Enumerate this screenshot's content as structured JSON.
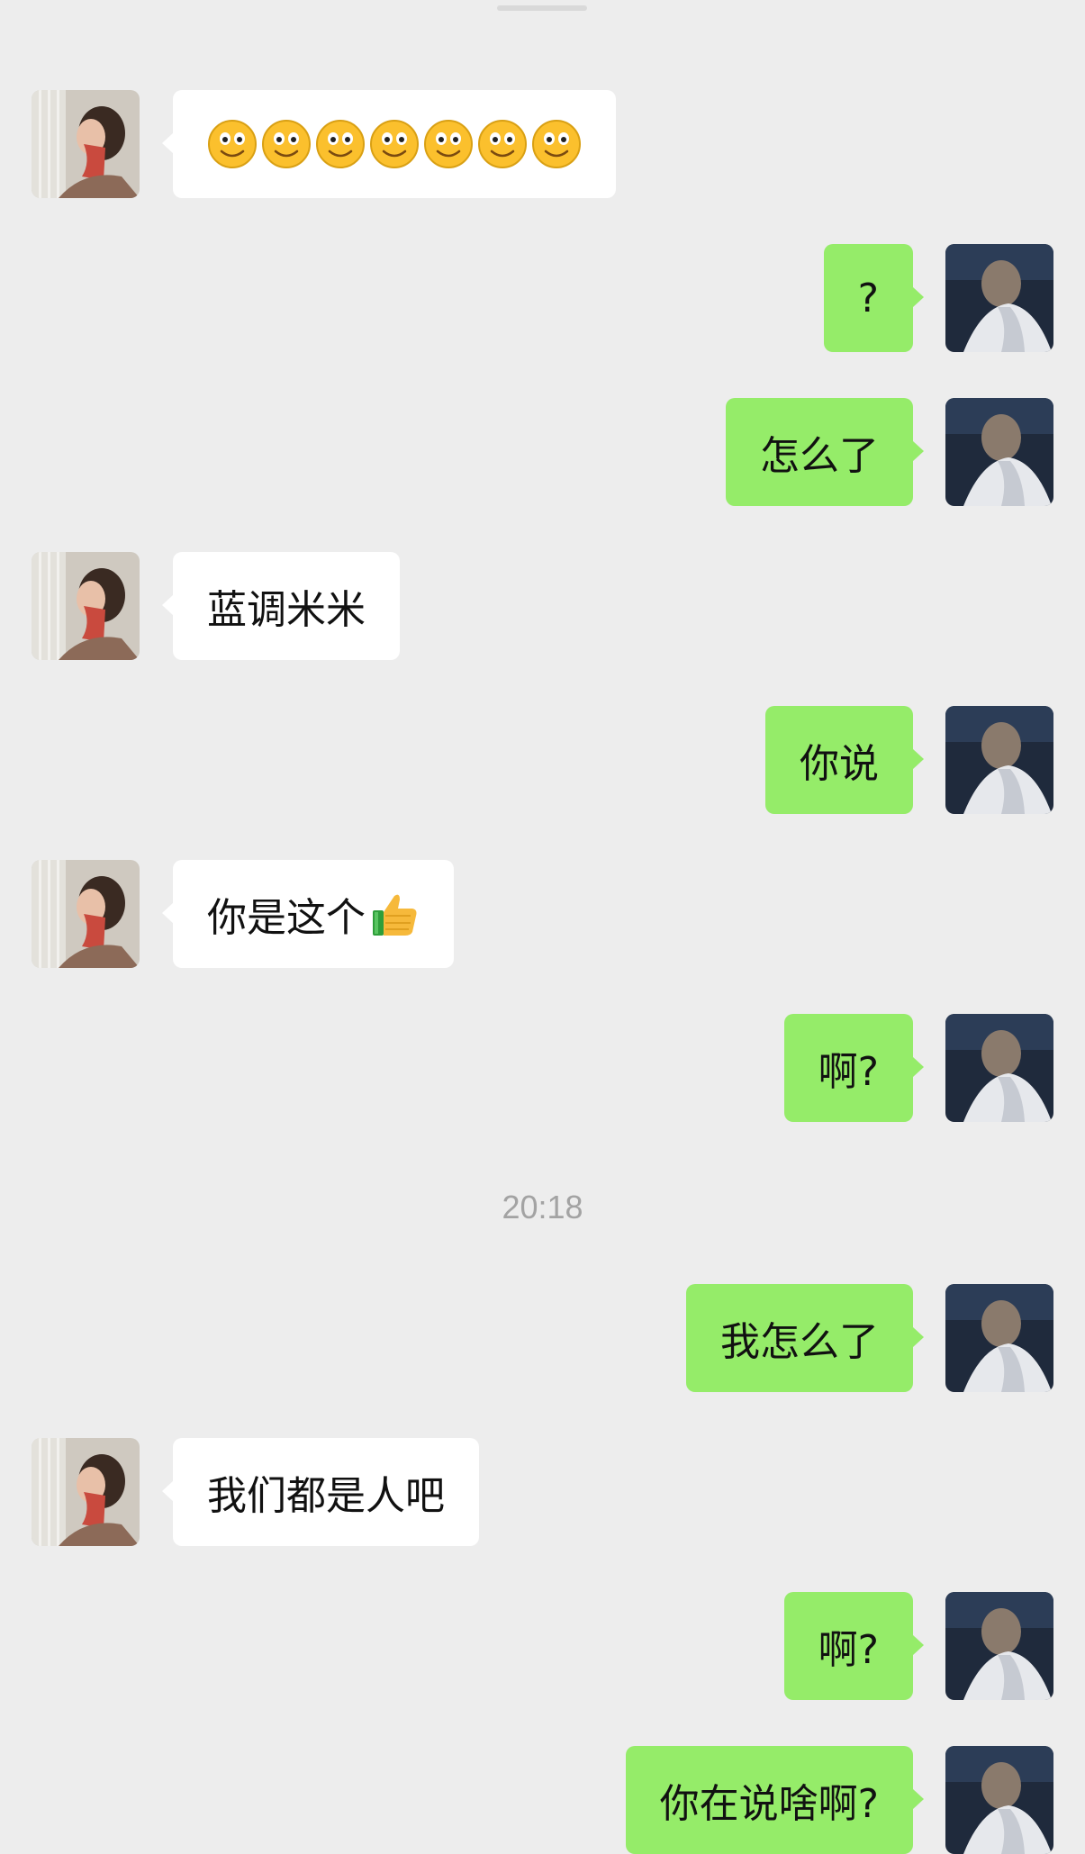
{
  "chat": {
    "timestamp": "20:18",
    "messages": [
      {
        "side": "received",
        "emoji": "slightly-smiling-face",
        "emoji_count": 7
      },
      {
        "side": "sent",
        "text": "?"
      },
      {
        "side": "sent",
        "text": "怎么了"
      },
      {
        "side": "received",
        "text": "蓝调米米"
      },
      {
        "side": "sent",
        "text": "你说"
      },
      {
        "side": "received",
        "text": "你是这个",
        "trailing_emoji": "thumbs-up"
      },
      {
        "side": "sent",
        "text": "啊?"
      },
      {
        "side": "sent",
        "text": "我怎么了"
      },
      {
        "side": "received",
        "text": "我们都是人吧"
      },
      {
        "side": "sent",
        "text": "啊?"
      },
      {
        "side": "sent",
        "text": "你在说啥啊?"
      }
    ]
  },
  "colors": {
    "background": "#ededed",
    "received_bubble": "#ffffff",
    "sent_bubble": "#95ec69",
    "text": "#111111",
    "timestamp": "#a3a3a3"
  }
}
